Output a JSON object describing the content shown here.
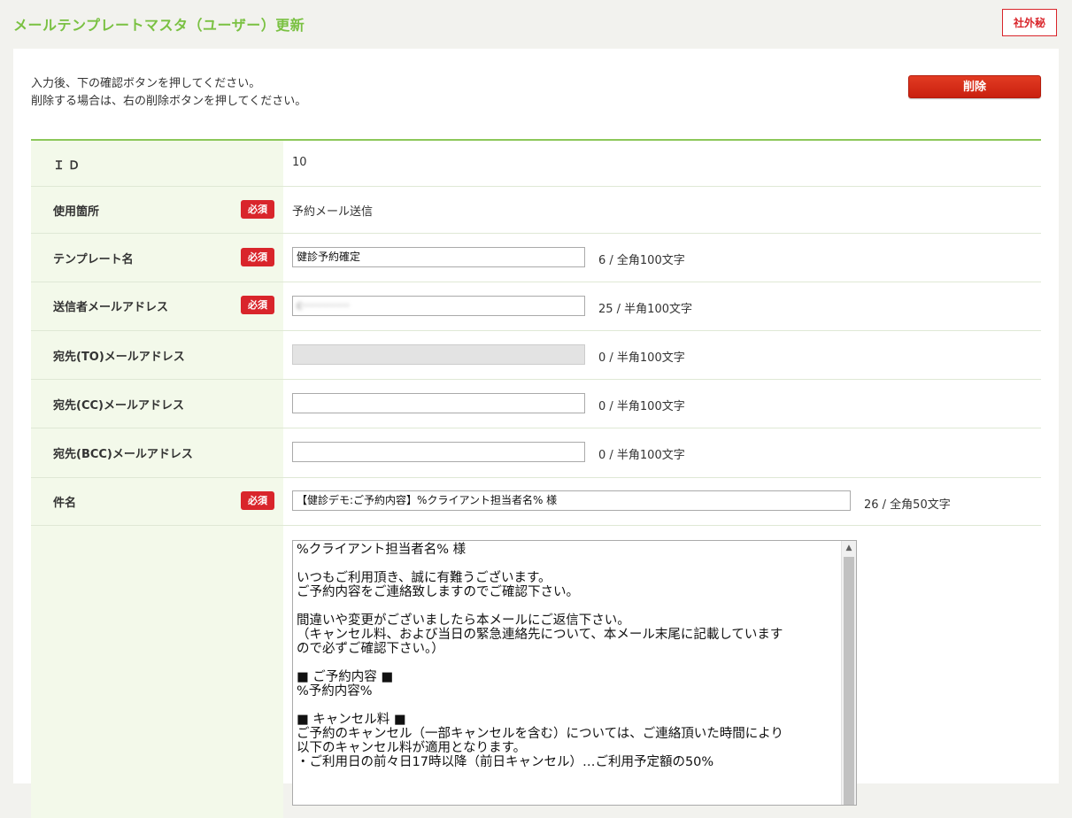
{
  "header": {
    "title": "メールテンプレートマスタ（ユーザー）更新",
    "confidential_badge": "社外秘"
  },
  "intro": {
    "line1": "入力後、下の確認ボタンを押してください。",
    "line2": "削除する場合は、右の削除ボタンを押してください。"
  },
  "actions": {
    "delete_label": "削除"
  },
  "required_label": "必須",
  "fields": {
    "id": {
      "label": "ＩＤ",
      "value": "10"
    },
    "usage": {
      "label": "使用箇所",
      "value": "予約メール送信"
    },
    "template_name": {
      "label": "テンプレート名",
      "value": "健診予約確定",
      "counter": "6 / 全角100文字"
    },
    "sender": {
      "label": "送信者メールアドレス",
      "value": "c··············",
      "counter": "25 / 半角100文字"
    },
    "to": {
      "label": "宛先(TO)メールアドレス",
      "value": "",
      "counter": "0 / 半角100文字"
    },
    "cc": {
      "label": "宛先(CC)メールアドレス",
      "value": "",
      "counter": "0 / 半角100文字"
    },
    "bcc": {
      "label": "宛先(BCC)メールアドレス",
      "value": "",
      "counter": "0 / 半角100文字"
    },
    "subject": {
      "label": "件名",
      "value": "【健診デモ:ご予約内容】%クライアント担当者名% 様",
      "counter": "26 / 全角50文字"
    },
    "body": {
      "value": "%クライアント担当者名% 様\n\nいつもご利用頂き、誠に有難うございます。\nご予約内容をご連絡致しますのでご確認下さい。\n\n間違いや変更がございましたら本メールにご返信下さい。\n（キャンセル料、および当日の緊急連絡先について、本メール末尾に記載しています\nので必ずご確認下さい。）\n\n■ ご予約内容 ■\n%予約内容%\n\n■ キャンセル料 ■\nご予約のキャンセル（一部キャンセルを含む）については、ご連絡頂いた時間により\n以下のキャンセル料が適用となります。\n・ご利用日の前々日17時以降（前日キャンセル）…ご利用予定額の50%"
    }
  }
}
